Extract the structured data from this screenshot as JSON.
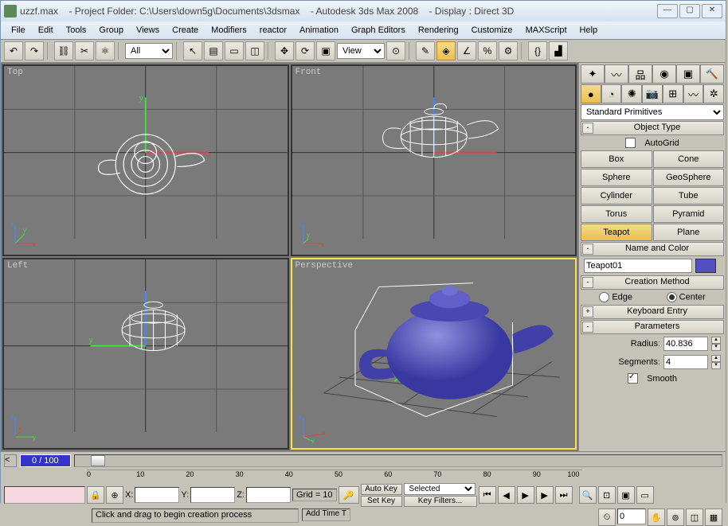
{
  "title": {
    "file": "uzzf.max",
    "folder": "- Project Folder: C:\\Users\\down5g\\Documents\\3dsmax",
    "app": "- Autodesk 3ds Max 2008",
    "display": "- Display : Direct 3D"
  },
  "menu": [
    "File",
    "Edit",
    "Tools",
    "Group",
    "Views",
    "Create",
    "Modifiers",
    "reactor",
    "Animation",
    "Graph Editors",
    "Rendering",
    "Customize",
    "MAXScript",
    "Help"
  ],
  "toolbar": {
    "selset": "All",
    "view": "View"
  },
  "viewports": {
    "v0": "Top",
    "v1": "Front",
    "v2": "Left",
    "v3": "Perspective"
  },
  "panel": {
    "dropdown": "Standard Primitives",
    "roll_objtype": "Object Type",
    "autogrid": "AutoGrid",
    "btns": [
      "Box",
      "Cone",
      "Sphere",
      "GeoSphere",
      "Cylinder",
      "Tube",
      "Torus",
      "Pyramid",
      "Teapot",
      "Plane"
    ],
    "roll_namecolor": "Name and Color",
    "objname": "Teapot01",
    "roll_method": "Creation Method",
    "edge": "Edge",
    "center": "Center",
    "roll_key": "Keyboard Entry",
    "roll_params": "Parameters",
    "radius_lbl": "Radius:",
    "radius": "40.836",
    "segs_lbl": "Segments:",
    "segs": "4",
    "smooth": "Smooth"
  },
  "timeline": {
    "frame": "0 / 100",
    "ticks": [
      "0",
      "10",
      "20",
      "30",
      "40",
      "50",
      "60",
      "70",
      "80",
      "90",
      "100"
    ]
  },
  "status": {
    "x": "X:",
    "y": "Y:",
    "z": "Z:",
    "grid": "Grid = 10",
    "autokey": "Auto Key",
    "setkey": "Set Key",
    "selected": "Selected",
    "keyfilters": "Key Filters...",
    "addtime": "Add Time T",
    "msg": "Click and drag to begin creation process"
  }
}
